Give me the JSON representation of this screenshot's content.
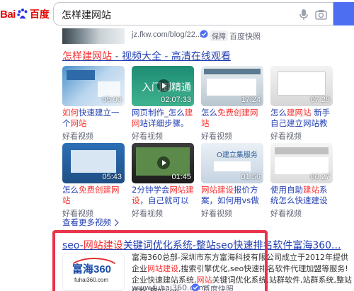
{
  "header": {
    "logo_left": "Bai",
    "logo_right": "百度",
    "query": "怎样建网站"
  },
  "top_result": {
    "url": "jz.fkw.com/blog/22...",
    "tag": "保障",
    "snapshot": "百度快照"
  },
  "video_section": {
    "title_prefix": "怎样",
    "title_hl": "建网站",
    "title_rest": " - 视频大全 - 高清在线观看",
    "cards": [
      {
        "duration": "05:00",
        "t1": "如何",
        "t2": "快速建立一个",
        "t3": "网站",
        "source": "好看视频"
      },
      {
        "duration": "02:07:33",
        "t1": "网页制作_怎么",
        "t2": "建网",
        "t3": "站详细步骤。网...",
        "source": "好看视频"
      },
      {
        "duration": "17:24",
        "t1": "怎么",
        "t2": "免费",
        "t3": "创建网站",
        "source": "好看视频"
      },
      {
        "duration": "07:29",
        "t1": "怎么",
        "t2": "建网站",
        "t3": " 新手自己建立网站教程",
        "source": "好看视频"
      },
      {
        "duration": "05:43",
        "t1": "怎么",
        "t2": "免费",
        "t3": "创建网站",
        "source": "好看视频"
      },
      {
        "duration": "01:45",
        "t1": "2分钟学会",
        "t2": "网站建设",
        "t3": "，自己就可以做网站",
        "source": "好看视频"
      },
      {
        "duration": "01:56",
        "t1": "网站建设",
        "t2": "报价方案，",
        "t3": "如何用vs做网站。",
        "source": "好看视频"
      },
      {
        "duration": "00:27",
        "t1": "使用自助",
        "t2": "建站",
        "t3": "系统怎么快速建设网站",
        "source": "好看视频"
      }
    ],
    "more": "查看更多视频"
  },
  "result": {
    "title_a": "seo-",
    "title_b": "网站建设",
    "title_c": "关键词优化系统-整站seo快速排名软件富海360...",
    "logo_text": "富海360",
    "logo_sub": "fuhai360.com",
    "desc_1": "富海360总部-深圳市东方富海科技有限公司成立于2012年提供企业",
    "desc_hl1": "网站建设",
    "desc_2": ",搜索引擎优化,seo快速排名软件代理加盟等服务!企业快速建站系统,",
    "desc_hl2": "网站",
    "desc_3": "关键词优化系统,站群软件,站群系统,整站优化,整站seo...",
    "url": "www.fuhai360.com/",
    "snapshot": "百度快照"
  },
  "colors": {
    "link": "#2440b3",
    "highlight": "#f73131",
    "annotation_box": "#e8334a",
    "search_button": "#4e6ef2"
  }
}
